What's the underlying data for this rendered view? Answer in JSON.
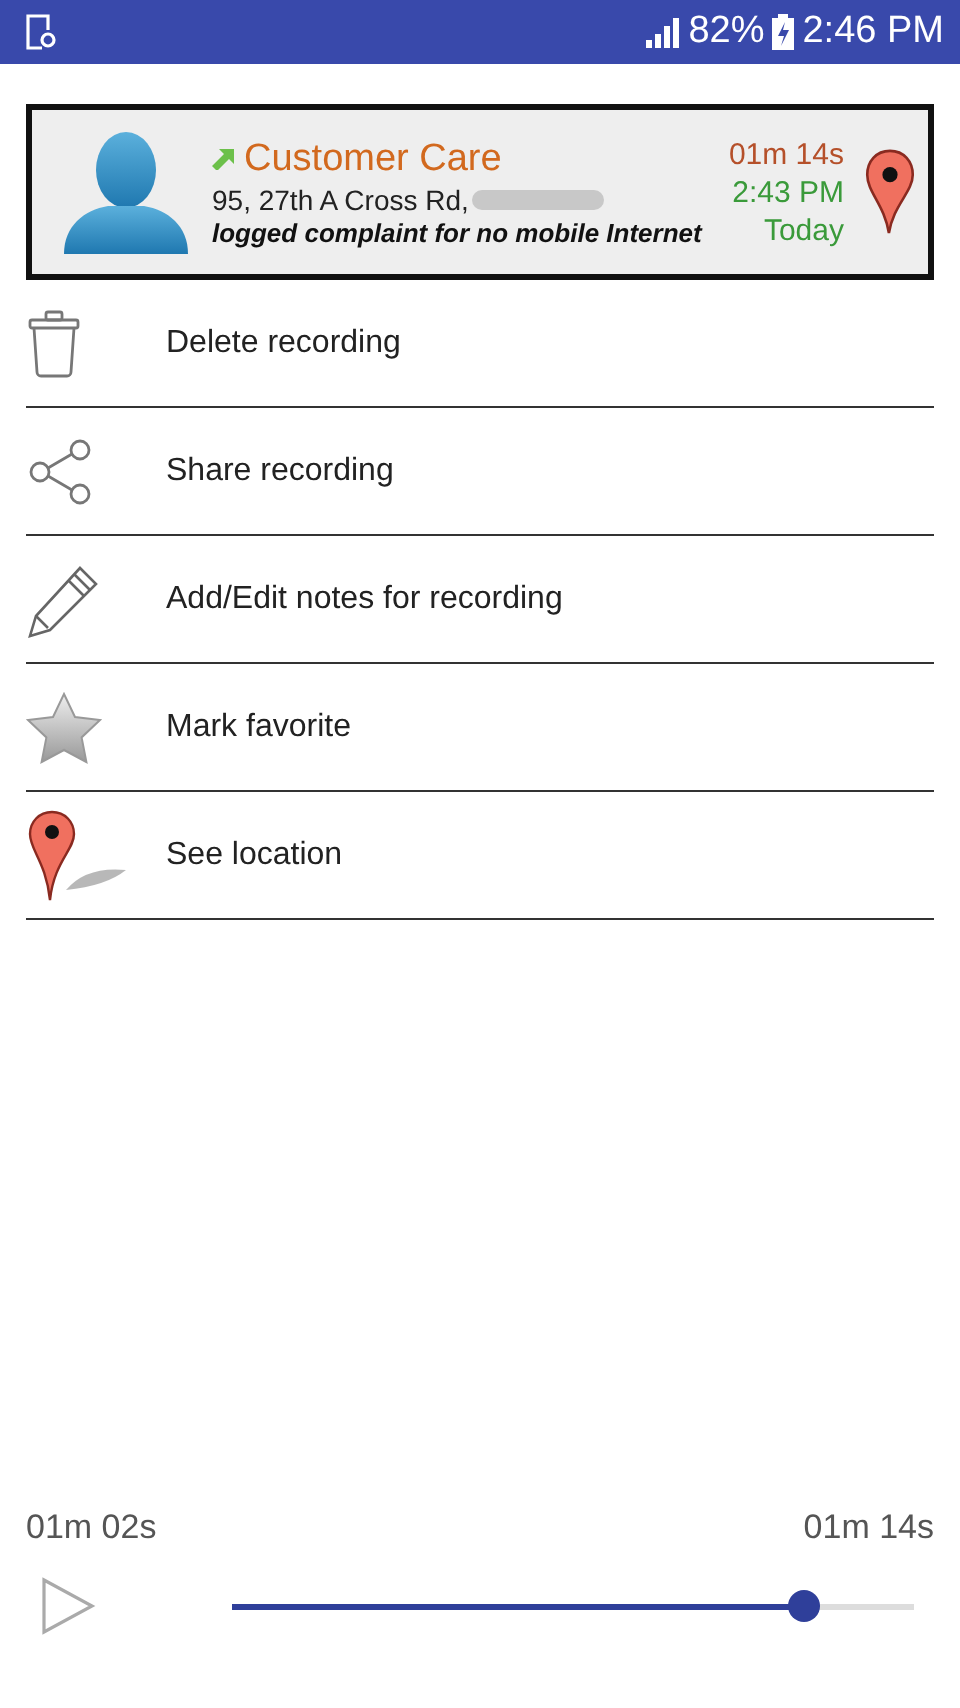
{
  "status_bar": {
    "battery": "82%",
    "time": "2:46 PM"
  },
  "call_card": {
    "name": "Customer Care",
    "address": "95, 27th A Cross Rd,",
    "note": "logged complaint for no mobile Internet",
    "duration": "01m 14s",
    "time": "2:43 PM",
    "day": "Today"
  },
  "actions": [
    {
      "kind": "trash",
      "label": "Delete recording"
    },
    {
      "kind": "share",
      "label": "Share recording"
    },
    {
      "kind": "pencil",
      "label": "Add/Edit notes for recording"
    },
    {
      "kind": "star",
      "label": "Mark favorite"
    },
    {
      "kind": "pin",
      "label": "See location"
    }
  ],
  "player": {
    "elapsed": "01m 02s",
    "total": "01m 14s",
    "level": 0.84
  }
}
